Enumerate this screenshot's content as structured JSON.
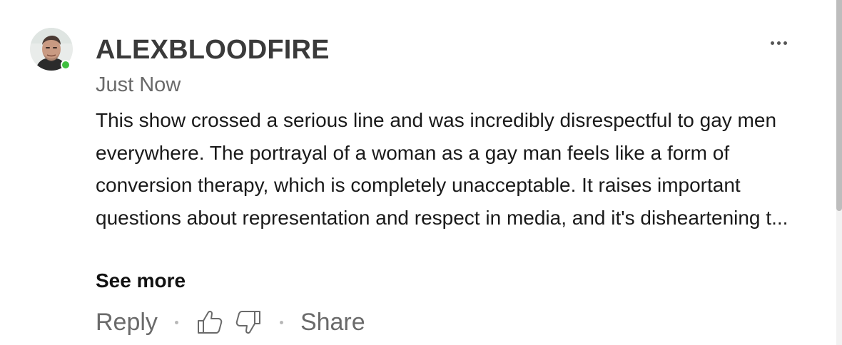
{
  "comment": {
    "author": "ALEXBLOODFIRE",
    "timestamp": "Just Now",
    "online": true,
    "body": "This show crossed a serious line and was incredibly disrespectful to gay men everywhere. The portrayal of a woman as a gay man feels like a form of conversion therapy, which is completely unacceptable. It raises important questions about representation and respect in media, and it's disheartening t...",
    "see_more_label": "See more",
    "more_icon": "more-horizontal-icon"
  },
  "actions": {
    "reply_label": "Reply",
    "share_label": "Share",
    "like_icon": "thumbs-up-icon",
    "dislike_icon": "thumbs-down-icon"
  },
  "colors": {
    "online": "#3fbf3f",
    "muted_text": "#6a6a6a",
    "author_text": "#3a3a3a",
    "body_text": "#1a1a1a"
  }
}
